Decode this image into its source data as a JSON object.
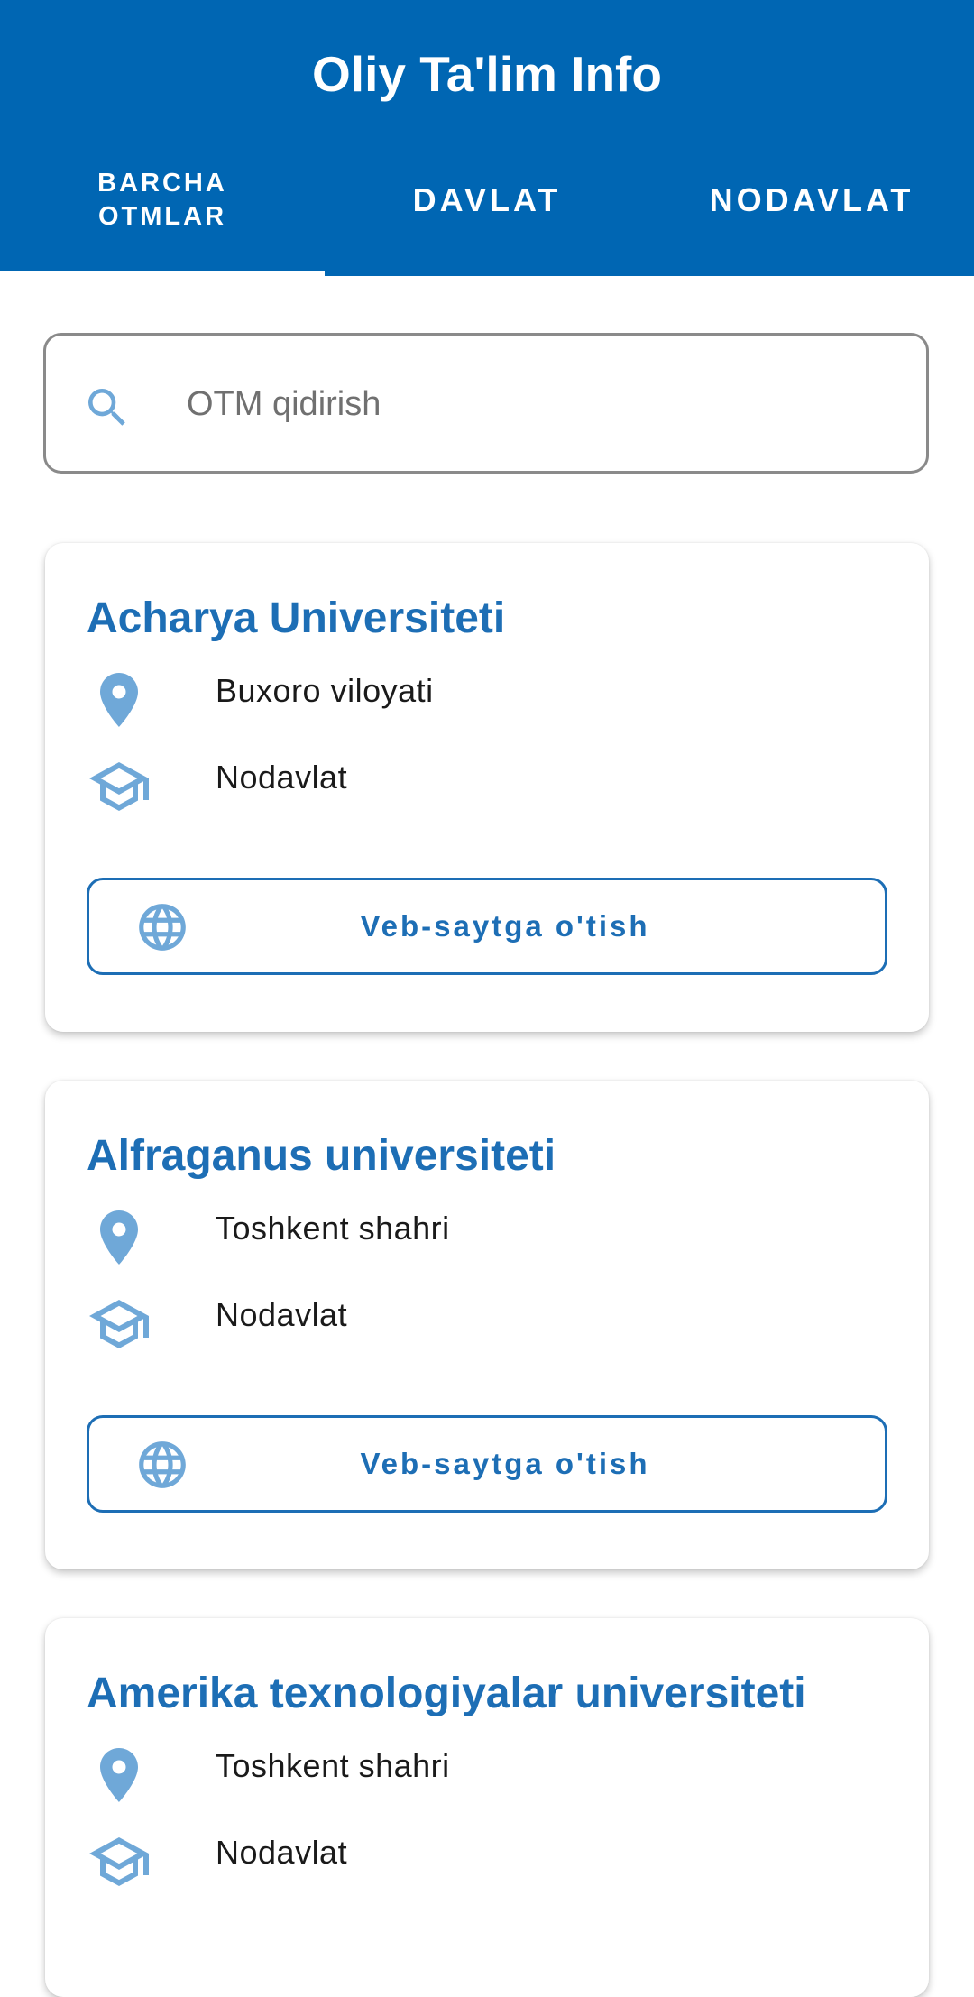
{
  "app": {
    "title": "Oliy Ta'lim Info"
  },
  "tabs": [
    {
      "label": "BARCHA OTMLAR",
      "selected": true
    },
    {
      "label": "DAVLAT",
      "selected": false
    },
    {
      "label": "NODAVLAT",
      "selected": false
    }
  ],
  "search": {
    "placeholder": "OTM qidirish",
    "value": "",
    "icon": "search-icon"
  },
  "colors": {
    "primary": "#0066B3",
    "accent": "#1d6eb5",
    "icon": "#6fa8d8"
  },
  "universities": [
    {
      "name": "Acharya Universiteti",
      "region": "Buxoro viloyati",
      "type": "Nodavlat",
      "website_button": "Veb-saytga o'tish"
    },
    {
      "name": "Alfraganus universiteti",
      "region": "Toshkent shahri",
      "type": "Nodavlat",
      "website_button": "Veb-saytga o'tish"
    },
    {
      "name": "Amerika texnologiyalar universiteti",
      "region": "Toshkent shahri",
      "type": "Nodavlat"
    }
  ]
}
